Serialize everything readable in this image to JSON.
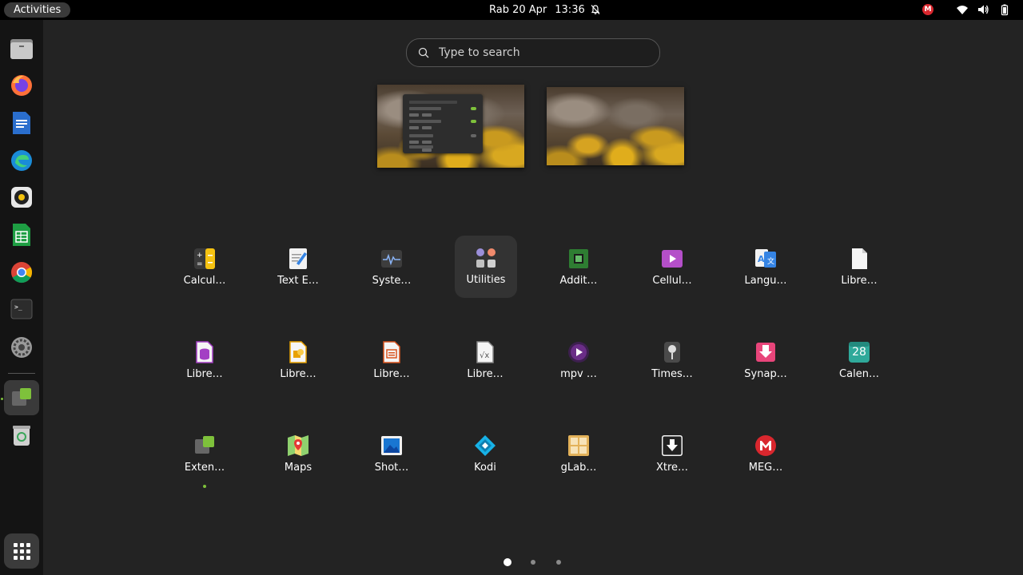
{
  "topbar": {
    "activities": "Activities",
    "date": "Rab 20 Apr",
    "time": "13:36",
    "tray_mega": "M"
  },
  "search": {
    "placeholder": "Type to search"
  },
  "apps_row1": [
    {
      "label": "Calcul…",
      "icon": "calculator-icon"
    },
    {
      "label": "Text E…",
      "icon": "text-editor-icon"
    },
    {
      "label": "Syste…",
      "icon": "system-monitor-icon"
    },
    {
      "label": "Utilities",
      "icon": "utilities-folder-icon"
    },
    {
      "label": "Addit…",
      "icon": "additional-drivers-icon"
    },
    {
      "label": "Cellul…",
      "icon": "celluloid-icon"
    },
    {
      "label": "Langu…",
      "icon": "language-support-icon"
    },
    {
      "label": "Libre…",
      "icon": "libreoffice-icon"
    }
  ],
  "apps_row2": [
    {
      "label": "Libre…",
      "icon": "libreoffice-base-icon"
    },
    {
      "label": "Libre…",
      "icon": "libreoffice-draw-icon"
    },
    {
      "label": "Libre…",
      "icon": "libreoffice-impress-icon"
    },
    {
      "label": "Libre…",
      "icon": "libreoffice-math-icon"
    },
    {
      "label": "mpv …",
      "icon": "mpv-icon"
    },
    {
      "label": "Times…",
      "icon": "timeshift-icon"
    },
    {
      "label": "Synap…",
      "icon": "synaptic-icon"
    },
    {
      "label": "Calen…",
      "icon": "calendar-icon",
      "value": "28"
    }
  ],
  "apps_row3": [
    {
      "label": "Exten…",
      "icon": "extensions-icon"
    },
    {
      "label": "Maps",
      "icon": "maps-icon"
    },
    {
      "label": "Shot…",
      "icon": "shotwell-icon"
    },
    {
      "label": "Kodi",
      "icon": "kodi-icon"
    },
    {
      "label": "gLab…",
      "icon": "glabels-icon"
    },
    {
      "label": "Xtre…",
      "icon": "xtreme-download-icon"
    },
    {
      "label": "MEG…",
      "icon": "mega-icon"
    }
  ],
  "dock": [
    "files-icon",
    "firefox-icon",
    "libreoffice-writer-icon",
    "edge-icon",
    "rhythmbox-icon",
    "libreoffice-calc-icon",
    "chrome-icon",
    "terminal-icon",
    "settings-icon",
    "extensions-icon",
    "trash-icon"
  ],
  "colors": {
    "accent_green": "#7ec13b",
    "mega_red": "#d9272e"
  }
}
